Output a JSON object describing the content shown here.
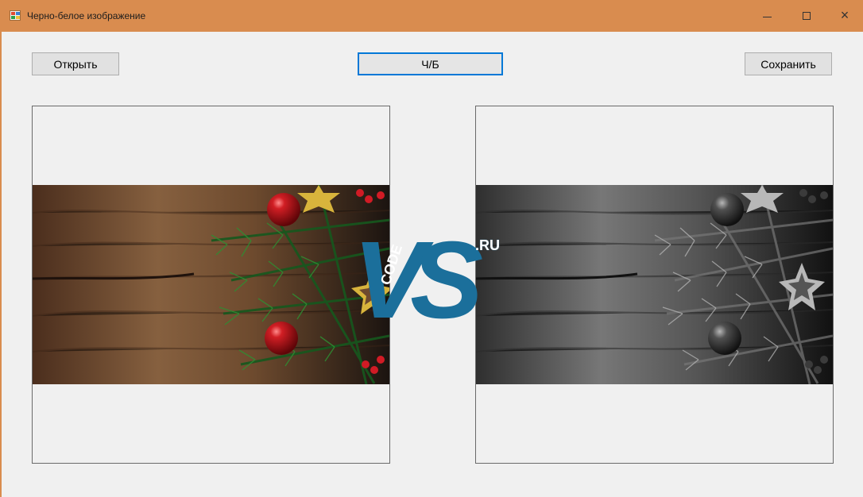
{
  "window": {
    "title": "Черно-белое изображение",
    "controls": {
      "minimize": "—",
      "maximize": "□",
      "close": "×"
    }
  },
  "toolbar": {
    "open_label": "Открыть",
    "bw_label": "Ч/Б",
    "save_label": "Сохранить"
  },
  "watermark": {
    "main": "VS",
    "code": "CODE",
    "suffix": ".RU"
  },
  "colors": {
    "titlebar": "#d98c4f",
    "client_background": "#f0f0f0",
    "focused_button_border": "#0078d7",
    "watermark_blue": "#1b6f9b"
  },
  "icons": {
    "app": "app-window-icon",
    "minimize": "minimize-icon",
    "maximize": "maximize-icon",
    "close": "close-icon"
  }
}
